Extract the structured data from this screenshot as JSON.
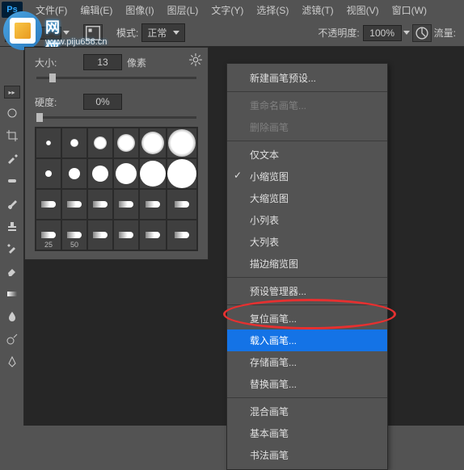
{
  "menubar": {
    "items": [
      "文件(F)",
      "编辑(E)",
      "图像(I)",
      "图层(L)",
      "文字(Y)",
      "选择(S)",
      "滤镜(T)",
      "视图(V)",
      "窗口(W)"
    ]
  },
  "watermark": {
    "line1": "网侠娱乐园",
    "line2": "www.piju656.cn"
  },
  "optbar": {
    "size": "13",
    "mode_label": "模式:",
    "mode_value": "正常",
    "opacity_label": "不透明度:",
    "opacity_value": "100%",
    "flow_label": "流量:"
  },
  "brush_panel": {
    "size_label": "大小:",
    "size_value": "13",
    "size_unit": "像素",
    "hardness_label": "硬度:",
    "hardness_value": "0%",
    "rows_with_labels": [
      "25",
      "50"
    ]
  },
  "context_menu": {
    "items": [
      {
        "label": "新建画笔预设...",
        "type": "item"
      },
      {
        "type": "sep"
      },
      {
        "label": "重命名画笔...",
        "type": "item",
        "disabled": true
      },
      {
        "label": "删除画笔",
        "type": "item",
        "disabled": true
      },
      {
        "type": "sep"
      },
      {
        "label": "仅文本",
        "type": "item"
      },
      {
        "label": "小缩览图",
        "type": "item",
        "checked": true
      },
      {
        "label": "大缩览图",
        "type": "item"
      },
      {
        "label": "小列表",
        "type": "item"
      },
      {
        "label": "大列表",
        "type": "item"
      },
      {
        "label": "描边缩览图",
        "type": "item"
      },
      {
        "type": "sep"
      },
      {
        "label": "预设管理器...",
        "type": "item"
      },
      {
        "type": "sep"
      },
      {
        "label": "复位画笔...",
        "type": "item"
      },
      {
        "label": "载入画笔...",
        "type": "item",
        "selected": true
      },
      {
        "label": "存储画笔...",
        "type": "item"
      },
      {
        "label": "替换画笔...",
        "type": "item"
      },
      {
        "type": "sep"
      },
      {
        "label": "混合画笔",
        "type": "item"
      },
      {
        "label": "基本画笔",
        "type": "item"
      },
      {
        "label": "书法画笔",
        "type": "item"
      }
    ]
  }
}
